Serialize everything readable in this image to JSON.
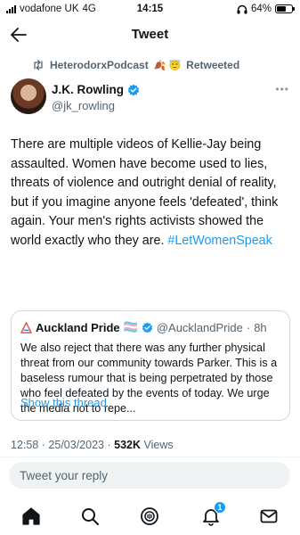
{
  "status_bar": {
    "carrier": "vodafone UK",
    "network": "4G",
    "time": "14:15",
    "battery": "64%",
    "battery_level": 0.64
  },
  "header": {
    "title": "Tweet",
    "back_icon": "arrow-left-icon"
  },
  "retweet": {
    "icon": "retweet-icon",
    "account": "HeterodorxPodcast",
    "emojis": "🍂 😇",
    "label": "Retweeted"
  },
  "author": {
    "name": "J.K. Rowling",
    "handle": "@jk_rowling",
    "verified_icon": "verified-badge-icon",
    "more_label": "•••"
  },
  "tweet": {
    "text": "There are multiple videos of Kellie-Jay being assaulted. Women have become used to lies, threats of violence and outright denial of reality, but if you imagine anyone feels 'defeated', think again. Your men's rights activists showed the world exactly who they are. ",
    "hashtag": "#LetWomenSpeak"
  },
  "quote": {
    "name": "Auckland Pride",
    "flag": "🏳️‍⚧️",
    "handle": "@AucklandPride",
    "separator": "·",
    "time": "8h",
    "text": "We also reject that there was any further physical threat from our community towards Parker. This is a baseless rumour that is being perpetrated by those who feel defeated by the events of today. We urge the media not to repe...",
    "show_thread": "Show this thread"
  },
  "meta": {
    "time": "12:58",
    "separator": "·",
    "date": "25/03/2023",
    "views_count": "532K",
    "views_label": "Views"
  },
  "reply": {
    "placeholder": "Tweet your reply"
  },
  "nav": {
    "notifications_badge": "1"
  },
  "colors": {
    "accent": "#1d9bf0",
    "text": "#0f1419",
    "secondary": "#536471",
    "border": "#cfd9de"
  }
}
